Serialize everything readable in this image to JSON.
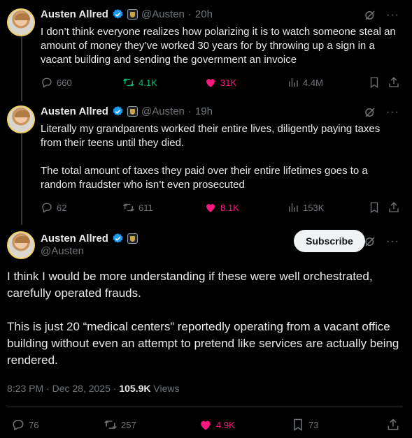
{
  "tweets": [
    {
      "name": "Austen Allred",
      "handle": "@Austen",
      "time": "20h",
      "text": "I don’t think everyone realizes how polarizing it is to watch someone steal an amount of money they’ve worked 30 years for by throwing up a sign in a vacant building and sending the government an invoice",
      "replies": "660",
      "reposts": "4.1K",
      "likes": "31K",
      "views": "4.4M"
    },
    {
      "name": "Austen Allred",
      "handle": "@Austen",
      "time": "19h",
      "text": "Literally my grandparents worked their entire lives, diligently paying taxes from their teens until they died.\n\nThe total amount of taxes they paid over their entire lifetimes goes to a random fraudster who isn’t even prosecuted",
      "replies": "62",
      "reposts": "611",
      "likes": "8.1K",
      "views": "153K"
    }
  ],
  "focus": {
    "name": "Austen Allred",
    "handle": "@Austen",
    "subscribe_label": "Subscribe",
    "text": "I think I would be more understanding if these were well orchestrated, carefully operated frauds.\n\nThis is just 20 “medical centers” reportedly operating from a vacant office building without even an attempt to pretend like services are actually being rendered.",
    "timestamp": "8:23 PM · Dec 28, 2025",
    "views_count": "105.9K",
    "views_label": "Views",
    "replies": "76",
    "reposts": "257",
    "likes": "4.9K",
    "bookmarks": "73"
  },
  "separator": "·",
  "colors": {
    "background": "#000000",
    "like": "#f91880",
    "repost": "#00ba7c",
    "verified": "#1d9bf0",
    "muted": "#71767b"
  },
  "icons": [
    "verified-badge-icon",
    "affiliate-badge-icon",
    "grok-icon",
    "more-icon",
    "reply-icon",
    "repost-icon",
    "like-icon",
    "views-icon",
    "bookmark-icon",
    "share-icon"
  ]
}
